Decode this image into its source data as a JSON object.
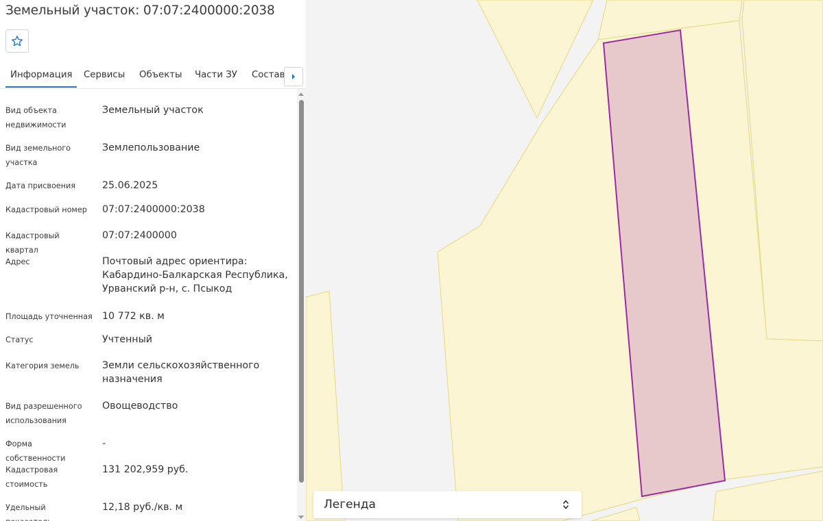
{
  "header": {
    "title": "Земельный участок: 07:07:2400000:2038",
    "favorite_icon": "star-outline-icon"
  },
  "tabs": [
    {
      "label": "Информация",
      "active": true
    },
    {
      "label": "Сервисы",
      "active": false
    },
    {
      "label": "Объекты",
      "active": false
    },
    {
      "label": "Части ЗУ",
      "active": false
    },
    {
      "label": "Состав",
      "active": false
    }
  ],
  "tabs_scroll_icon": "caret-right-icon",
  "info": [
    {
      "label": "Вид объекта недвижимости",
      "value": "Земельный участок"
    },
    {
      "label": "Вид земельного участка",
      "value": "Землепользование"
    },
    {
      "label": "Дата присвоения",
      "value": "25.06.2025"
    },
    {
      "label": "Кадастровый номер",
      "value": "07:07:2400000:2038"
    },
    {
      "label": "Кадастровый квартал",
      "value": "07:07:2400000"
    },
    {
      "label": "Адрес",
      "value": "Почтовый адрес ориентира: Кабардино-Балкарская Республика, Урванский р-н, с. Псыкод"
    },
    {
      "label": "Площадь уточненная",
      "value": "10 772 кв. м"
    },
    {
      "label": "Статус",
      "value": "Учтенный"
    },
    {
      "label": "Категория земель",
      "value": "Земли сельскохозяйственного назначения"
    },
    {
      "label": "Вид разрешенного использования",
      "value": "Овощеводство"
    },
    {
      "label": "Форма собственности",
      "value": "-"
    },
    {
      "label": "Кадастровая стоимость",
      "value": "131 202,959 руб."
    },
    {
      "label": "Удельный показатель",
      "value": "12,18 руб./кв. м"
    }
  ],
  "map": {
    "legend_label": "Легенда",
    "legend_icon": "chevron-up-down-icon",
    "colors": {
      "background": "#f3f3f3",
      "parcel_fill": "#fbf5d3",
      "parcel_border": "#e9dc8e",
      "selected_fill": "#e8c9cb",
      "selected_border": "#9b2aa3",
      "accent": "#1b74c8"
    }
  }
}
